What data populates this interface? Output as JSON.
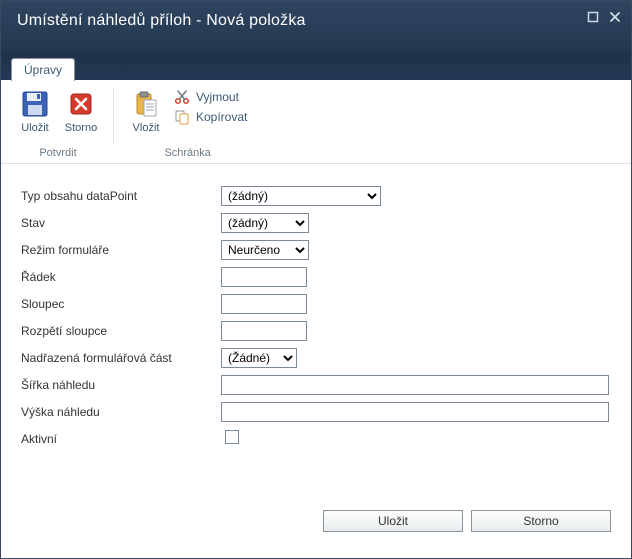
{
  "window": {
    "title": "Umístění náhledů příloh - Nová položka"
  },
  "tabs": {
    "edit": "Úpravy"
  },
  "ribbon": {
    "save": "Uložit",
    "cancel": "Storno",
    "paste": "Vložit",
    "cut": "Vyjmout",
    "copy": "Kopírovat",
    "group_confirm": "Potvrdit",
    "group_clipboard": "Schránka"
  },
  "form": {
    "content_type": {
      "label": "Typ obsahu dataPoint",
      "value": "(žádný)",
      "options": [
        "(žádný)"
      ]
    },
    "state": {
      "label": "Stav",
      "value": "(žádný)",
      "options": [
        "(žádný)"
      ]
    },
    "form_mode": {
      "label": "Režim formuláře",
      "value": "Neurčeno",
      "options": [
        "Neurčeno"
      ]
    },
    "row": {
      "label": "Řádek",
      "value": ""
    },
    "column": {
      "label": "Sloupec",
      "value": ""
    },
    "colspan": {
      "label": "Rozpětí sloupce",
      "value": ""
    },
    "parent_part": {
      "label": "Nadřazená formulářová část",
      "value": "(Žádné)",
      "options": [
        "(Žádné)"
      ]
    },
    "preview_w": {
      "label": "Šířka náhledu",
      "value": ""
    },
    "preview_h": {
      "label": "Výška náhledu",
      "value": ""
    },
    "active": {
      "label": "Aktivní",
      "value": false
    }
  },
  "footer": {
    "save": "Uložit",
    "cancel": "Storno"
  }
}
